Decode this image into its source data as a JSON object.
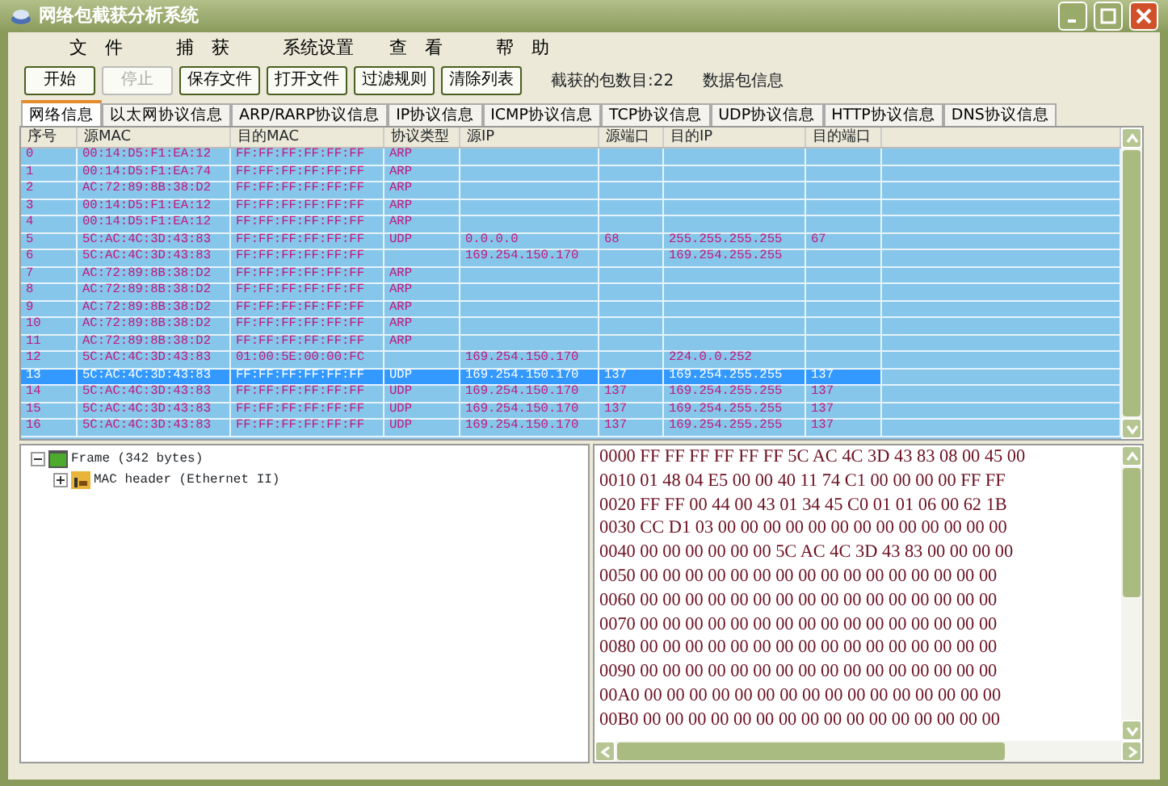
{
  "window": {
    "title": "网络包截获分析系统"
  },
  "menu": [
    "文　件",
    "捕　获",
    "系统设置",
    "查　看",
    "帮　助"
  ],
  "toolbar": {
    "buttons": [
      {
        "label": "开始",
        "disabled": false
      },
      {
        "label": "停止",
        "disabled": true
      },
      {
        "label": "保存文件",
        "disabled": false
      },
      {
        "label": "打开文件",
        "disabled": false
      },
      {
        "label": "过滤规则",
        "disabled": false
      },
      {
        "label": "清除列表",
        "disabled": false
      }
    ],
    "packet_count": "截获的包数目:22",
    "packet_info_label": "数据包信息"
  },
  "tabs": [
    {
      "label": "网络信息",
      "selected": true
    },
    {
      "label": "以太网协议信息",
      "selected": false
    },
    {
      "label": "ARP/RARP协议信息",
      "selected": false
    },
    {
      "label": "IP协议信息",
      "selected": false
    },
    {
      "label": "ICMP协议信息",
      "selected": false
    },
    {
      "label": "TCP协议信息",
      "selected": false
    },
    {
      "label": "UDP协议信息",
      "selected": false
    },
    {
      "label": "HTTP协议信息",
      "selected": false
    },
    {
      "label": "DNS协议信息",
      "selected": false
    }
  ],
  "packet_table": {
    "columns": [
      "序号",
      "源MAC",
      "目的MAC",
      "协议类型",
      "源IP",
      "源端口",
      "目的IP",
      "目的端口"
    ],
    "rows": [
      {
        "no": "0",
        "src_mac": "00:14:D5:F1:EA:12",
        "dst_mac": "FF:FF:FF:FF:FF:FF",
        "protocol": "ARP",
        "selected": false
      },
      {
        "no": "1",
        "src_mac": "00:14:D5:F1:EA:74",
        "dst_mac": "FF:FF:FF:FF:FF:FF",
        "protocol": "ARP",
        "selected": false
      },
      {
        "no": "2",
        "src_mac": "AC:72:89:8B:38:D2",
        "dst_mac": "FF:FF:FF:FF:FF:FF",
        "protocol": "ARP",
        "selected": false
      },
      {
        "no": "3",
        "src_mac": "00:14:D5:F1:EA:12",
        "dst_mac": "FF:FF:FF:FF:FF:FF",
        "protocol": "ARP",
        "selected": false
      },
      {
        "no": "4",
        "src_mac": "00:14:D5:F1:EA:12",
        "dst_mac": "FF:FF:FF:FF:FF:FF",
        "protocol": "ARP",
        "selected": false
      },
      {
        "no": "5",
        "src_mac": "5C:AC:4C:3D:43:83",
        "dst_mac": "FF:FF:FF:FF:FF:FF",
        "protocol": "UDP",
        "src_ip": "0.0.0.0",
        "src_port": "68",
        "dst_ip": "255.255.255.255",
        "dst_port": "67",
        "selected": false
      },
      {
        "no": "6",
        "src_mac": "5C:AC:4C:3D:43:83",
        "dst_mac": "FF:FF:FF:FF:FF:FF",
        "src_ip": "169.254.150.170",
        "dst_ip": "169.254.255.255",
        "selected": false
      },
      {
        "no": "7",
        "src_mac": "AC:72:89:8B:38:D2",
        "dst_mac": "FF:FF:FF:FF:FF:FF",
        "protocol": "ARP",
        "selected": false
      },
      {
        "no": "8",
        "src_mac": "AC:72:89:8B:38:D2",
        "dst_mac": "FF:FF:FF:FF:FF:FF",
        "protocol": "ARP",
        "selected": false
      },
      {
        "no": "9",
        "src_mac": "AC:72:89:8B:38:D2",
        "dst_mac": "FF:FF:FF:FF:FF:FF",
        "protocol": "ARP",
        "selected": false
      },
      {
        "no": "10",
        "src_mac": "AC:72:89:8B:38:D2",
        "dst_mac": "FF:FF:FF:FF:FF:FF",
        "protocol": "ARP",
        "selected": false
      },
      {
        "no": "11",
        "src_mac": "AC:72:89:8B:38:D2",
        "dst_mac": "FF:FF:FF:FF:FF:FF",
        "protocol": "ARP",
        "selected": false
      },
      {
        "no": "12",
        "src_mac": "5C:AC:4C:3D:43:83",
        "dst_mac": "01:00:5E:00:00:FC",
        "src_ip": "169.254.150.170",
        "dst_ip": "224.0.0.252",
        "selected": false
      },
      {
        "no": "13",
        "src_mac": "5C:AC:4C:3D:43:83",
        "dst_mac": "FF:FF:FF:FF:FF:FF",
        "protocol": "UDP",
        "src_ip": "169.254.150.170",
        "src_port": "137",
        "dst_ip": "169.254.255.255",
        "dst_port": "137",
        "selected": true
      },
      {
        "no": "14",
        "src_mac": "5C:AC:4C:3D:43:83",
        "dst_mac": "FF:FF:FF:FF:FF:FF",
        "protocol": "UDP",
        "src_ip": "169.254.150.170",
        "src_port": "137",
        "dst_ip": "169.254.255.255",
        "dst_port": "137",
        "selected": false
      },
      {
        "no": "15",
        "src_mac": "5C:AC:4C:3D:43:83",
        "dst_mac": "FF:FF:FF:FF:FF:FF",
        "protocol": "UDP",
        "src_ip": "169.254.150.170",
        "src_port": "137",
        "dst_ip": "169.254.255.255",
        "dst_port": "137",
        "selected": false
      },
      {
        "no": "16",
        "src_mac": "5C:AC:4C:3D:43:83",
        "dst_mac": "FF:FF:FF:FF:FF:FF",
        "protocol": "UDP",
        "src_ip": "169.254.150.170",
        "src_port": "137",
        "dst_ip": "169.254.255.255",
        "dst_port": "137",
        "selected": false
      }
    ]
  },
  "packet_tree": [
    {
      "label": "Frame (342 bytes)",
      "expanded": true,
      "children": [
        {
          "label": "MAC header (Ethernet II)",
          "expanded": false
        }
      ]
    }
  ],
  "hex_dump": [
    "0000 FF FF FF FF FF FF 5C AC 4C 3D 43 83 08 00 45 00",
    "0010 01 48 04 E5 00 00 40 11 74 C1 00 00 00 00 FF FF",
    "0020 FF FF 00 44 00 43 01 34 45 C0 01 01 06 00 62 1B",
    "0030 CC D1 03 00 00 00 00 00 00 00 00 00 00 00 00 00",
    "0040 00 00 00 00 00 00 5C AC 4C 3D 43 83 00 00 00 00",
    "0050 00 00 00 00 00 00 00 00 00 00 00 00 00 00 00 00",
    "0060 00 00 00 00 00 00 00 00 00 00 00 00 00 00 00 00",
    "0070 00 00 00 00 00 00 00 00 00 00 00 00 00 00 00 00",
    "0080 00 00 00 00 00 00 00 00 00 00 00 00 00 00 00 00",
    "0090 00 00 00 00 00 00 00 00 00 00 00 00 00 00 00 00",
    "00A0 00 00 00 00 00 00 00 00 00 00 00 00 00 00 00 00",
    "00B0 00 00 00 00 00 00 00 00 00 00 00 00 00 00 00 00"
  ]
}
